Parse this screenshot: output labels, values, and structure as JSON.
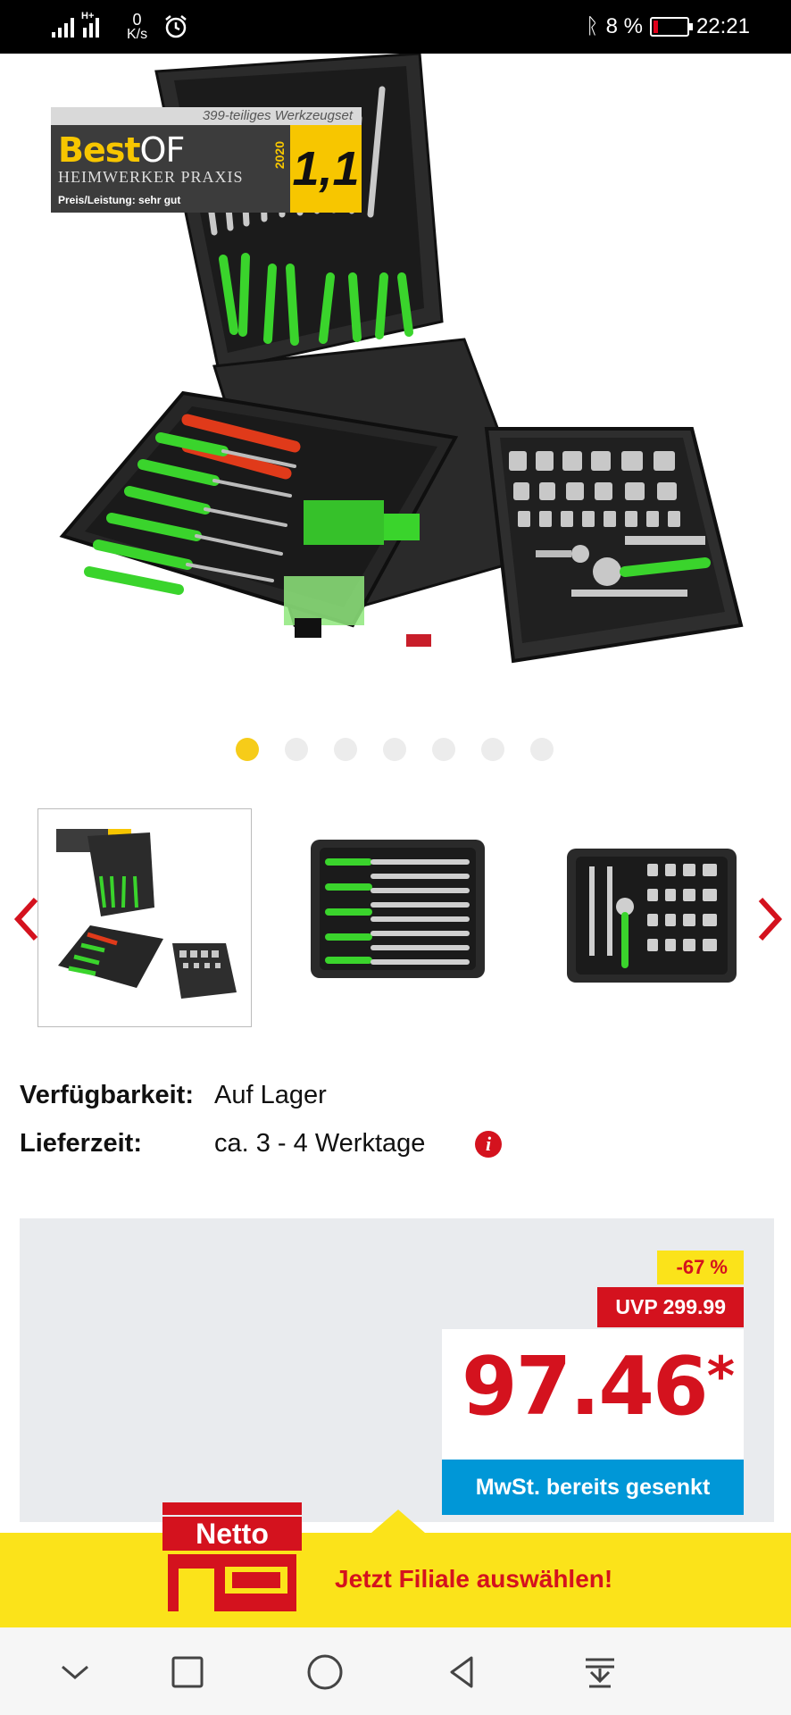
{
  "status_bar": {
    "network_plus": "H+",
    "speed_value": "0",
    "speed_unit": "K/s",
    "battery_text": "8 %",
    "time": "22:21"
  },
  "badge": {
    "subtitle": "399-teiliges Werkzeugset",
    "brand_best": "Best",
    "brand_of": "OF",
    "magazine": "HEIMWERKER PRAXIS",
    "year": "2020",
    "score": "1,1",
    "rating": "Preis/Leistung: sehr gut"
  },
  "gallery": {
    "dot_count": 7,
    "active_index": 0
  },
  "availability": {
    "label": "Verfügbarkeit:",
    "value": "Auf Lager"
  },
  "delivery": {
    "label": "Lieferzeit:",
    "value": "ca. 3 - 4 Werktage",
    "info_icon": "i"
  },
  "pricing": {
    "discount": "-67 %",
    "uvp": "UVP 299.99",
    "price": "97.46",
    "price_suffix": "*",
    "tax_note": "MwSt. bereits gesenkt"
  },
  "store_banner": {
    "logo_text": "Netto",
    "cta": "Jetzt Filiale auswählen!"
  },
  "colors": {
    "brand_red": "#d4121e",
    "brand_yellow": "#fbe31a",
    "accent_blue": "#0097d7",
    "dot_active": "#f6cc19",
    "panel_gray": "#e9ebee"
  },
  "icons": {
    "nav": [
      "chevron-down-icon",
      "square-icon",
      "circle-home-icon",
      "triangle-back-icon",
      "download-icon"
    ],
    "gallery": [
      "chevron-left-icon",
      "chevron-right-icon"
    ]
  }
}
